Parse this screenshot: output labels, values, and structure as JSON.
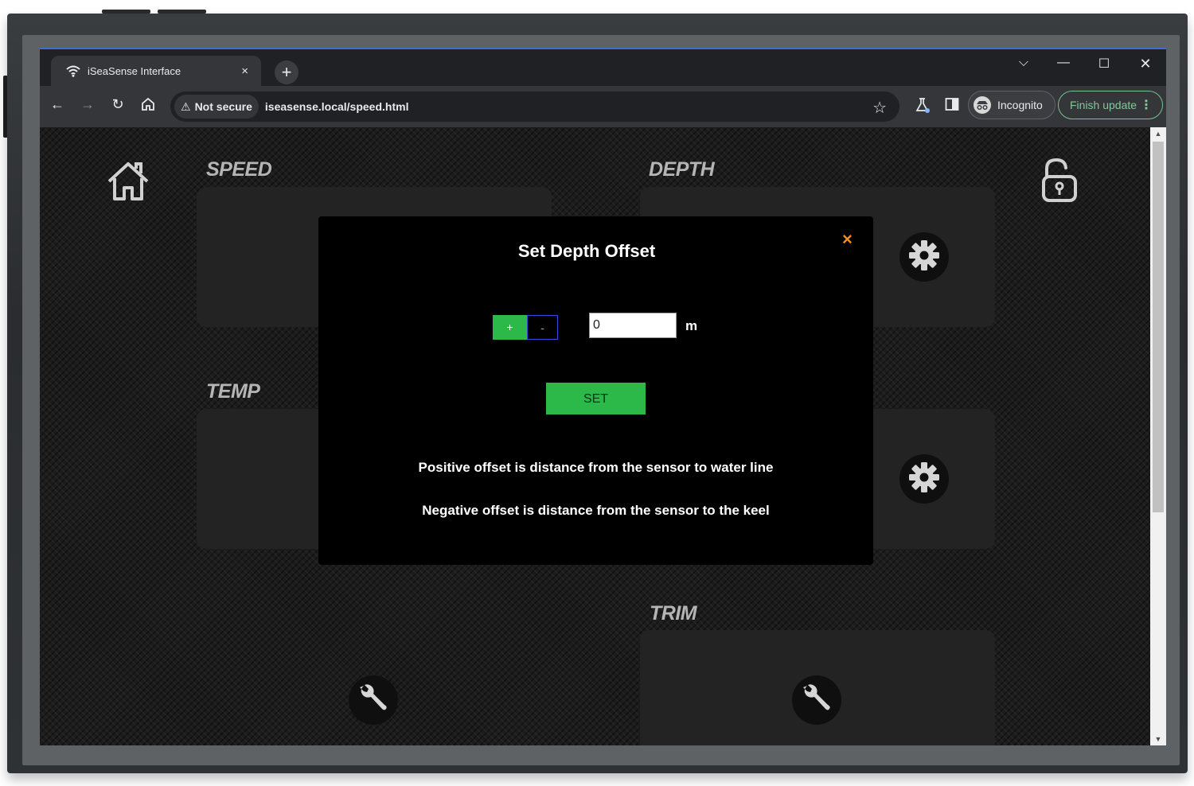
{
  "browser": {
    "tab_title": "iSeaSense Interface",
    "tab_close": "×",
    "new_tab": "+",
    "security_chip": "Not secure",
    "url": "iseasense.local/speed.html",
    "incognito_label": "Incognito",
    "finish_update_label": "Finish update"
  },
  "page": {
    "sections": {
      "speed": "SPEED",
      "depth": "DEPTH",
      "temp": "TEMP",
      "trim": "TRIM"
    }
  },
  "modal": {
    "title": "Set Depth Offset",
    "close": "×",
    "plus_label": "+",
    "minus_label": "-",
    "offset_value": "0",
    "unit": "m",
    "set_label": "SET",
    "info_positive": "Positive offset is distance from the sensor to water line",
    "info_negative": "Negative offset is distance from the sensor to the keel"
  },
  "colors": {
    "accent_green": "#2db84a",
    "close_orange": "#ff8c1a",
    "finish_green": "#81c995"
  }
}
